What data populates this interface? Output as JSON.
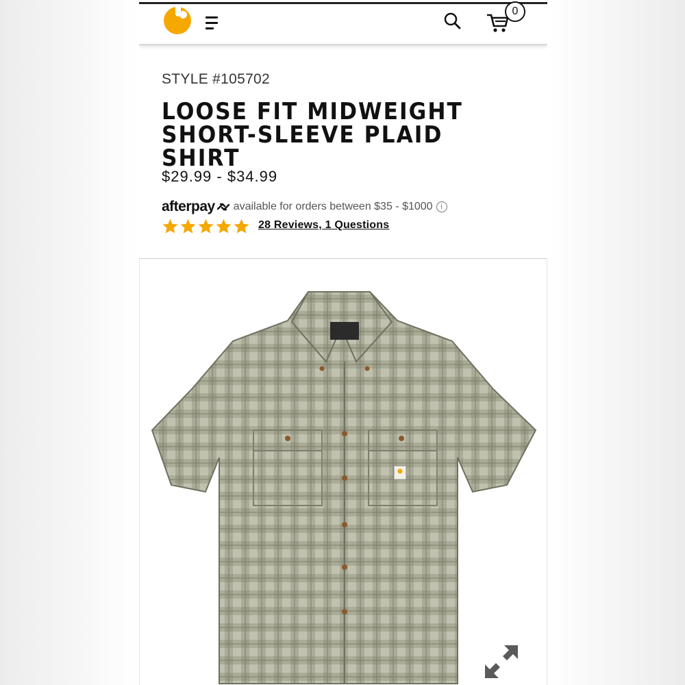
{
  "header": {
    "cart_count": "0"
  },
  "product": {
    "style": "STYLE #105702",
    "title_line1": "LOOSE FIT MIDWEIGHT",
    "title_line2": "SHORT-SLEEVE PLAID SHIRT",
    "price": "$29.99 - $34.99",
    "afterpay_brand": "afterpay",
    "afterpay_text": "available for orders between $35 - $1000",
    "info_glyph": "i",
    "rating": 5,
    "rating_max": 5,
    "reviews_link": "28 Reviews, 1 Questions"
  },
  "icons": [
    "carhartt-logo-icon",
    "menu-icon",
    "search-icon",
    "cart-icon",
    "afterpay-arrows-icon",
    "info-icon",
    "star-icon",
    "expand-icon"
  ],
  "colors": {
    "brand": "#f5a800",
    "star": "#f5a800",
    "text": "#111111",
    "shirt": "#8d8f7a"
  }
}
